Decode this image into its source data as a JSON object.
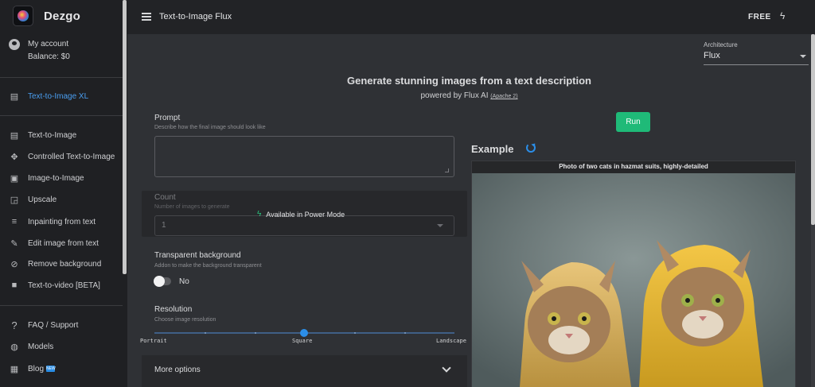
{
  "app": {
    "brand": "Dezgo",
    "page_title": "Text-to-Image Flux",
    "plan_label": "FREE"
  },
  "sidebar": {
    "account_label": "My account",
    "balance": "Balance: $0",
    "active_item": "Text-to-Image XL",
    "items": [
      {
        "label": "Text-to-Image",
        "icon": "chat-icon"
      },
      {
        "label": "Controlled Text-to-Image",
        "icon": "move-icon"
      },
      {
        "label": "Image-to-Image",
        "icon": "image-icon"
      },
      {
        "label": "Upscale",
        "icon": "upscale-icon"
      },
      {
        "label": "Inpainting from text",
        "icon": "wrap-text-icon"
      },
      {
        "label": "Edit image from text",
        "icon": "edit-note-icon"
      },
      {
        "label": "Remove background",
        "icon": "no-image-icon"
      },
      {
        "label": "Text-to-video [BETA]",
        "icon": "video-icon"
      }
    ],
    "footer_items": [
      {
        "label": "FAQ / Support",
        "icon": "help-icon"
      },
      {
        "label": "Models",
        "icon": "models-icon"
      },
      {
        "label": "Blog",
        "icon": "blog-icon",
        "badge": "NEW"
      }
    ]
  },
  "architecture": {
    "label": "Architecture",
    "value": "Flux"
  },
  "hero": {
    "headline": "Generate stunning images from a text description",
    "powered_by": "powered by Flux AI",
    "license": "(Apache 2)"
  },
  "form": {
    "prompt": {
      "label": "Prompt",
      "hint": "Describe how the final image should look like",
      "value": ""
    },
    "count": {
      "label": "Count",
      "hint": "Number of images to generate",
      "value": "1",
      "locked_note": "Available in Power Mode"
    },
    "transparent_background": {
      "label": "Transparent background",
      "hint": "Addon to make the background transparent",
      "value": "No"
    },
    "resolution": {
      "label": "Resolution",
      "hint": "Choose image resolution",
      "options": [
        "Portrait",
        "Square",
        "Landscape"
      ],
      "selected": "Square"
    },
    "more_options_label": "More options"
  },
  "run_label": "Run",
  "example": {
    "title": "Example",
    "caption": "Photo of two cats in hazmat suits, highly-detailed"
  },
  "colors": {
    "accent_green": "#1fba78",
    "accent_blue": "#2b8ee8",
    "link_blue": "#4a9ef0"
  }
}
